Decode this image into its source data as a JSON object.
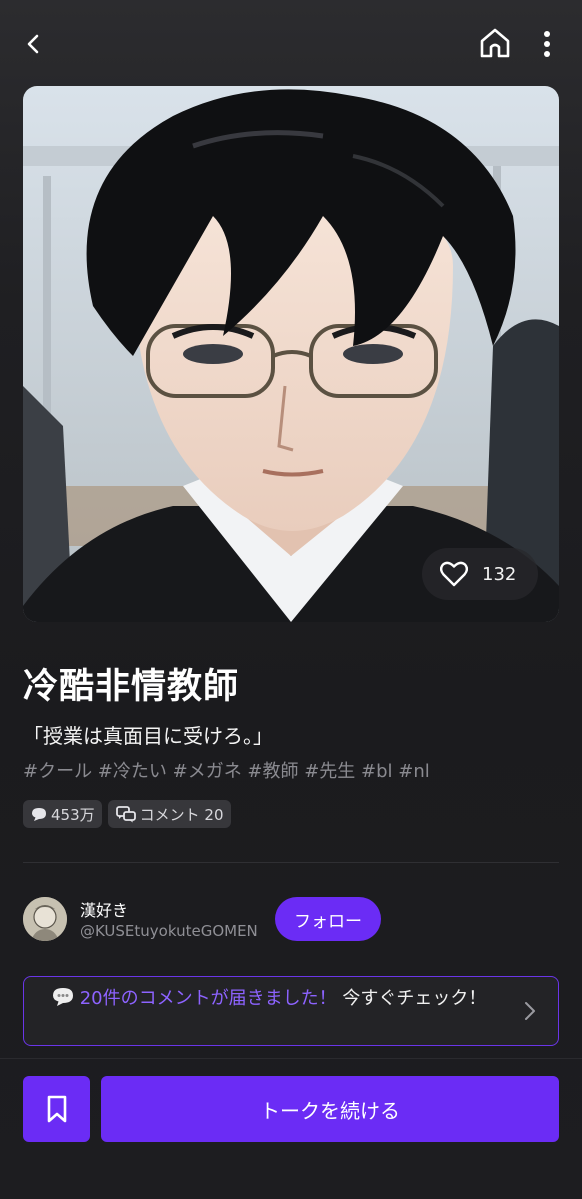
{
  "nav": {
    "back_icon": "chevron-left-icon",
    "home_icon": "home-icon",
    "more_icon": "more-vertical-icon"
  },
  "character": {
    "name": "冷酷非情教師",
    "tagline": "「授業は真面目に受けろ。」",
    "tags": "#クール #冷たい #メガネ #教師 #先生 #bl #nl",
    "likes": "132",
    "chats": "453万",
    "comments_label": "コメント 20"
  },
  "creator": {
    "name": "漢好き",
    "handle": "@KUSEtuyokuteGOMEN",
    "follow_label": "フォロー"
  },
  "notice": {
    "highlight": "20件のコメントが届きました！",
    "text": " 今すぐチェック！"
  },
  "actions": {
    "talk_label": "トークを続ける",
    "bookmark_icon": "bookmark-icon"
  },
  "colors": {
    "accent": "#6b2cf5",
    "background": "#1e1e21"
  }
}
